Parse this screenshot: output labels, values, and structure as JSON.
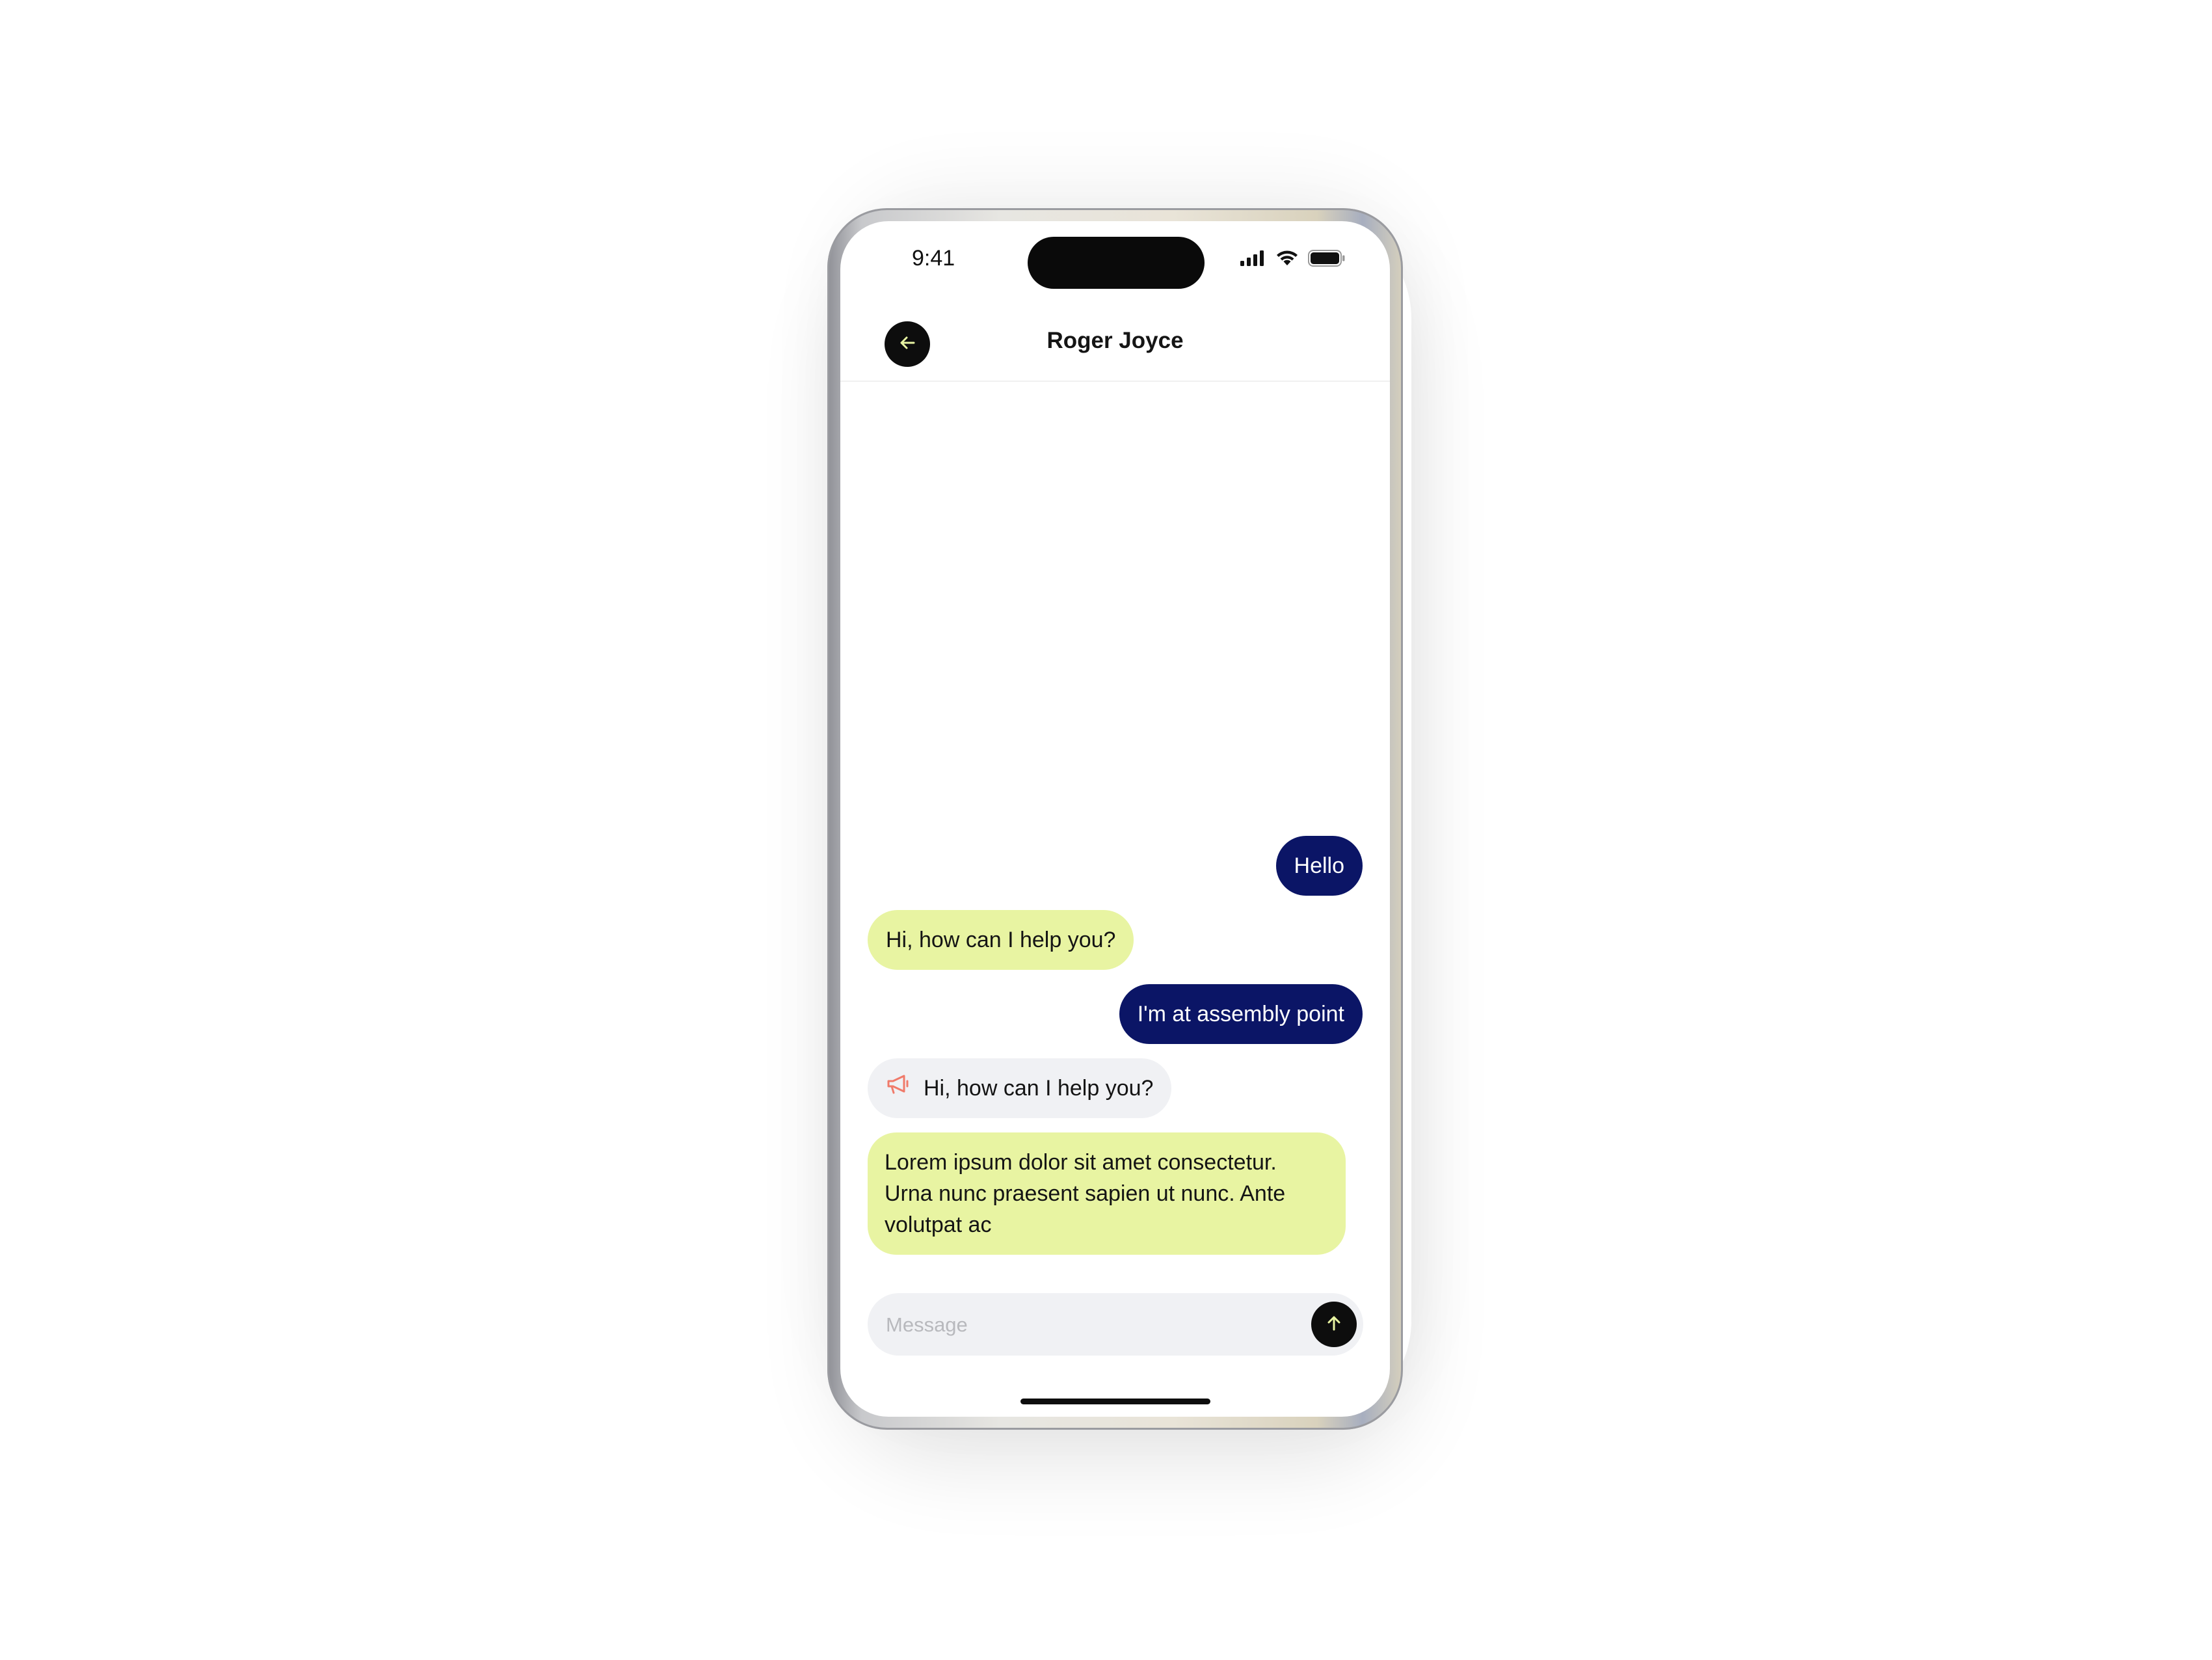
{
  "status_bar": {
    "time": "9:41",
    "icons": [
      "signal-icon",
      "wifi-icon",
      "battery-icon"
    ]
  },
  "header": {
    "back_icon": "arrow-left-icon",
    "title": "Roger Joyce"
  },
  "messages": [
    {
      "type": "sent",
      "text": "Hello"
    },
    {
      "type": "received",
      "text": "Hi, how can I help you?"
    },
    {
      "type": "sent",
      "text": "I'm at assembly point"
    },
    {
      "type": "system",
      "icon": "megaphone-icon",
      "text": "Hi, how can I help you?"
    },
    {
      "type": "received",
      "text": "Lorem ipsum dolor sit amet consectetur. Urna nunc praesent sapien ut nunc. Ante volutpat ac"
    }
  ],
  "composer": {
    "placeholder": "Message",
    "send_icon": "arrow-up-icon"
  },
  "colors": {
    "sent_bubble": "#0b1566",
    "received_bubble": "#e8f4a2",
    "system_bubble": "#f0f1f4",
    "megaphone": "#f07a6a",
    "accent_arrow": "#e8f4a2"
  }
}
